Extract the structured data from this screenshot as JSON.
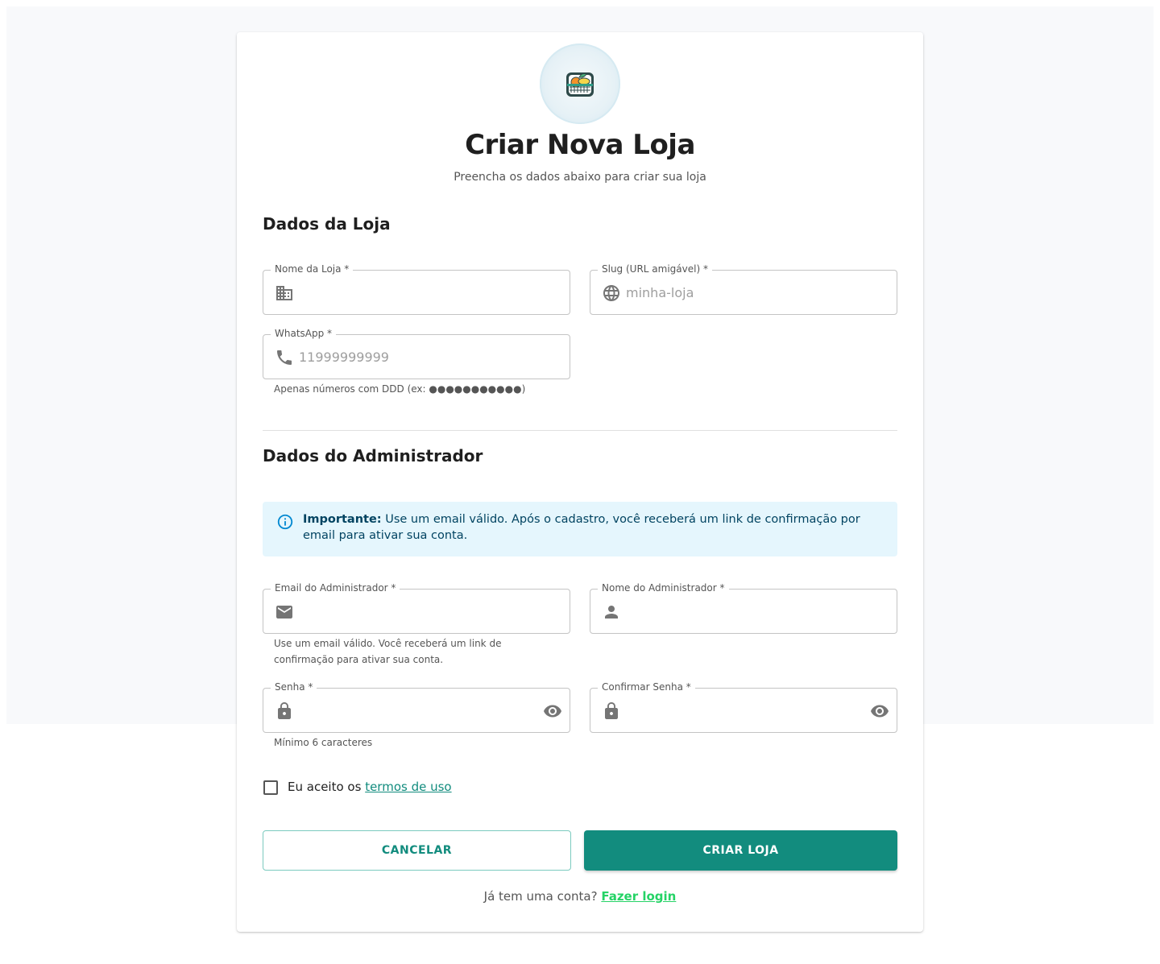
{
  "header": {
    "logo_icon": "grocery-basket-icon",
    "title": "Criar Nova Loja",
    "subtitle": "Preencha os dados abaixo para criar sua loja"
  },
  "store_section": {
    "title": "Dados da Loja",
    "store_name": {
      "label": "Nome da Loja *",
      "value": "",
      "placeholder": "",
      "icon": "building-icon"
    },
    "slug": {
      "label": "Slug (URL amigável) *",
      "value": "",
      "placeholder": "minha-loja",
      "icon": "globe-icon"
    },
    "whatsapp": {
      "label": "WhatsApp *",
      "value": "",
      "placeholder": "11999999999",
      "icon": "phone-icon",
      "helper": "Apenas números com DDD (ex: ●●●●●●●●●●●)"
    }
  },
  "admin_section": {
    "title": "Dados do Administrador",
    "alert": {
      "icon": "info-icon",
      "strong": "Importante:",
      "text": " Use um email válido. Após o cadastro, você receberá um link de confirmação por email para ativar sua conta."
    },
    "email": {
      "label": "Email do Administrador *",
      "value": "",
      "icon": "mail-icon",
      "helper": "Use um email válido. Você receberá um link de confirmação para ativar sua conta."
    },
    "admin_name": {
      "label": "Nome do Administrador *",
      "value": "",
      "icon": "person-icon"
    },
    "password": {
      "label": "Senha *",
      "value": "",
      "icon": "lock-icon",
      "toggle_icon": "eye-icon",
      "helper": "Mínimo 6 caracteres"
    },
    "confirm_password": {
      "label": "Confirmar Senha *",
      "value": "",
      "icon": "lock-icon",
      "toggle_icon": "eye-icon"
    }
  },
  "terms": {
    "checked": false,
    "text": "Eu aceito os ",
    "link": "termos de uso"
  },
  "actions": {
    "cancel": "CANCELAR",
    "create": "CRIAR LOJA"
  },
  "footer": {
    "text": "Já tem uma conta? ",
    "link": "Fazer login"
  },
  "colors": {
    "primary": "#128c7e",
    "login_link": "#25d366",
    "alert_bg": "#e5f6fd",
    "alert_text": "#014361"
  }
}
